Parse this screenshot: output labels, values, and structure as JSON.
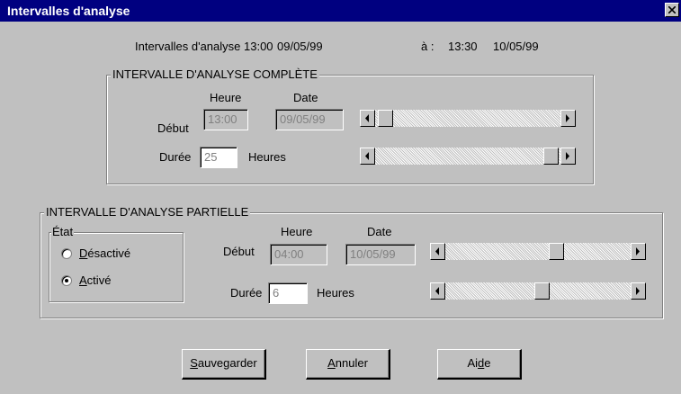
{
  "window": {
    "title": "Intervalles d'analyse"
  },
  "summary": {
    "label": "Intervalles d'analyse 13:00",
    "start_date": "09/05/99",
    "to_label": "à :",
    "end_time": "13:30",
    "end_date": "10/05/99"
  },
  "complete": {
    "legend": "INTERVALLE D'ANALYSE COMPLÈTE",
    "heure_header": "Heure",
    "date_header": "Date",
    "debut_label": "Début",
    "debut_heure": "13:00",
    "debut_date": "09/05/99",
    "duree_label": "Durée",
    "duree_value": "25",
    "duree_unit": "Heures",
    "debut_slider_position": 0.05,
    "duree_slider_position": 1.0
  },
  "partial": {
    "legend": "INTERVALLE D'ANALYSE PARTIELLE",
    "etat_legend": "État",
    "radio_desactive": "Désactivé",
    "radio_active": "Activé",
    "selected_state": "Activé",
    "heure_header": "Heure",
    "date_header": "Date",
    "debut_label": "Début",
    "debut_heure": "04:00",
    "debut_date": "10/05/99",
    "duree_label": "Durée",
    "duree_value": "6",
    "duree_unit": "Heures",
    "debut_slider_position": 0.63,
    "duree_slider_position": 0.55
  },
  "buttons": {
    "save": "Sauvegarder",
    "cancel": "Annuler",
    "help": "Aide"
  },
  "colors": {
    "titlebar": "#000080",
    "dialog": "#c0c0c0"
  }
}
